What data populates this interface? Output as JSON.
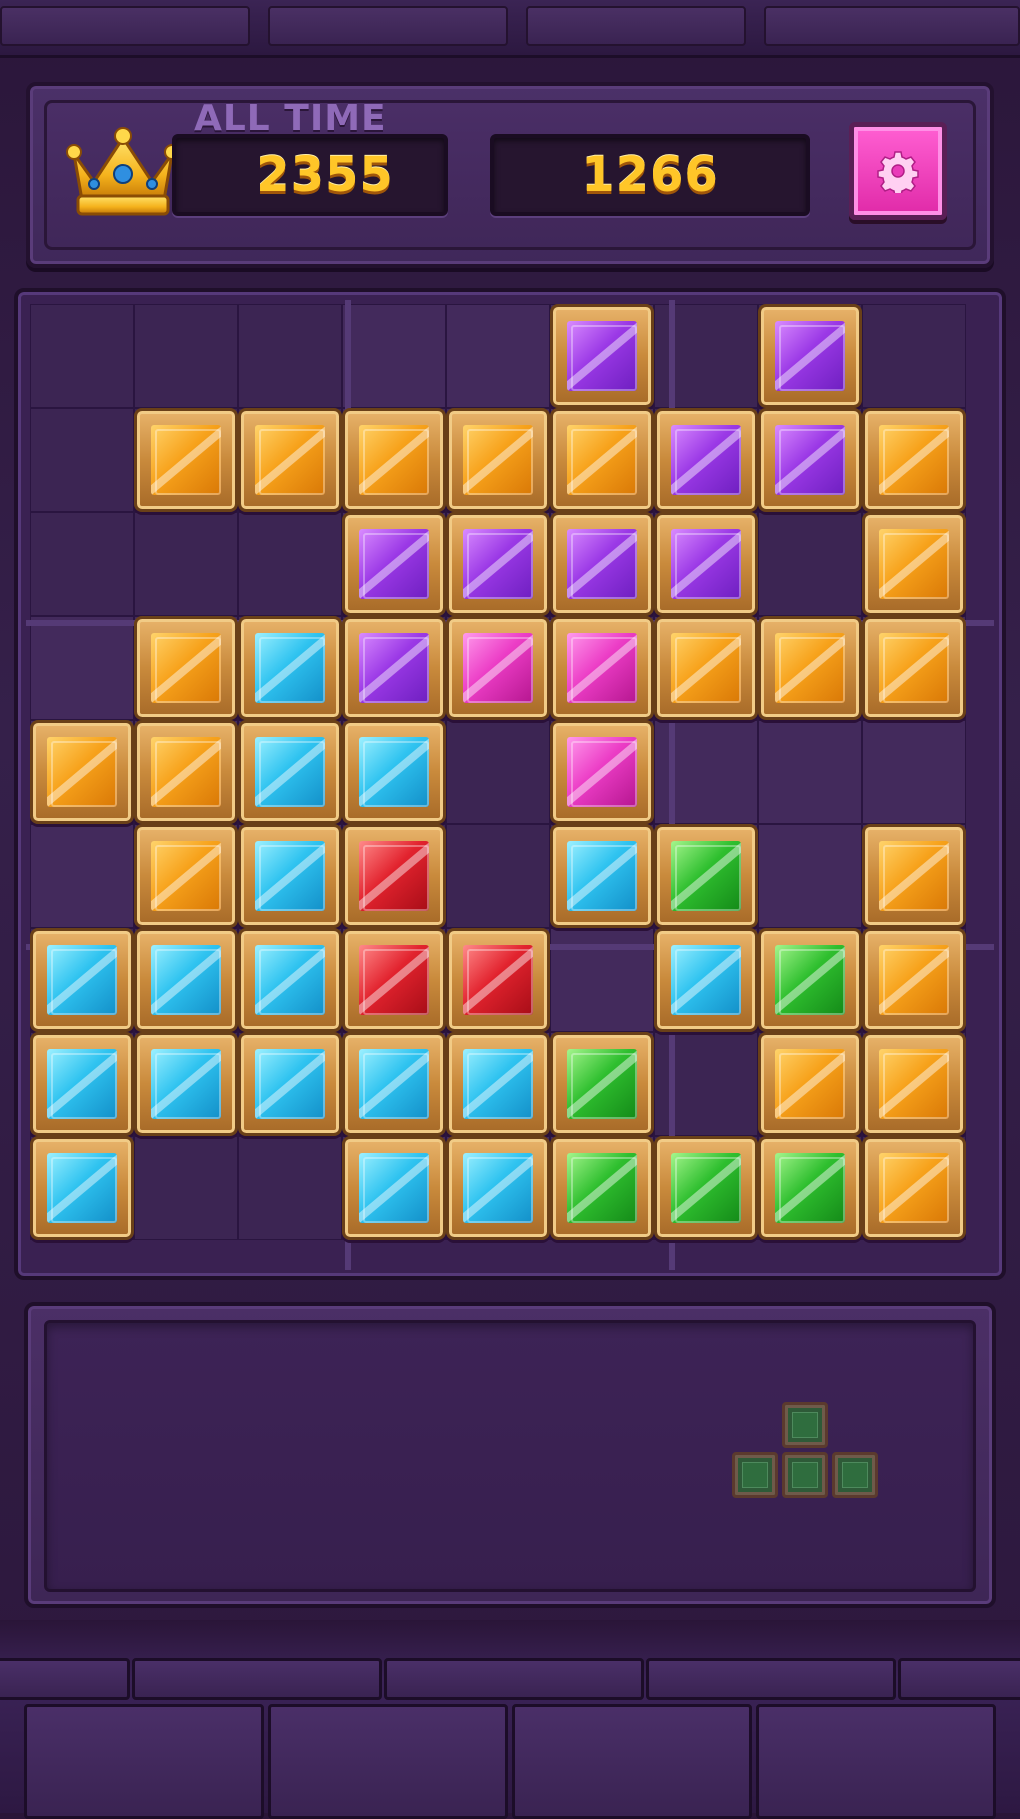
{
  "header": {
    "all_time_label": "ALL TIME",
    "best_score": "2355",
    "current_score": "1266"
  },
  "icons": {
    "crown": "crown-icon",
    "settings": "gear-icon"
  },
  "colors": {
    "orange": "#f7a21b",
    "purple": "#9b39e6",
    "cyan": "#2fc3f0",
    "magenta": "#ec3dc6",
    "red": "#e2232e",
    "green": "#2fbf2f",
    "settings_button": "#e93bb9",
    "score_text": "#ffc628"
  },
  "board": {
    "size": 9,
    "rows": [
      [
        null,
        null,
        null,
        null,
        null,
        "purple",
        null,
        "purple",
        null
      ],
      [
        null,
        "orange",
        "orange",
        "orange",
        "orange",
        "orange",
        "purple",
        "purple",
        "orange"
      ],
      [
        null,
        null,
        null,
        "purple",
        "purple",
        "purple",
        "purple",
        null,
        "orange"
      ],
      [
        null,
        "orange",
        "cyan",
        "purple",
        "magenta",
        "magenta",
        "orange",
        "orange",
        "orange"
      ],
      [
        "orange",
        "orange",
        "cyan",
        "cyan",
        null,
        "magenta",
        null,
        null,
        null
      ],
      [
        null,
        "orange",
        "cyan",
        "red",
        null,
        "cyan",
        "green",
        null,
        "orange"
      ],
      [
        "cyan",
        "cyan",
        "cyan",
        "red",
        "red",
        null,
        "cyan",
        "green",
        "orange"
      ],
      [
        "cyan",
        "cyan",
        "cyan",
        "cyan",
        "cyan",
        "green",
        null,
        "orange",
        "orange"
      ],
      [
        "cyan",
        null,
        null,
        "cyan",
        "cyan",
        "green",
        "green",
        "green",
        "orange"
      ]
    ]
  },
  "tray": {
    "pieces": [
      {
        "name": "t-piece",
        "color": "green",
        "cells": [
          [
            0,
            1
          ],
          [
            1,
            0
          ],
          [
            1,
            1
          ],
          [
            1,
            2
          ]
        ]
      }
    ]
  }
}
